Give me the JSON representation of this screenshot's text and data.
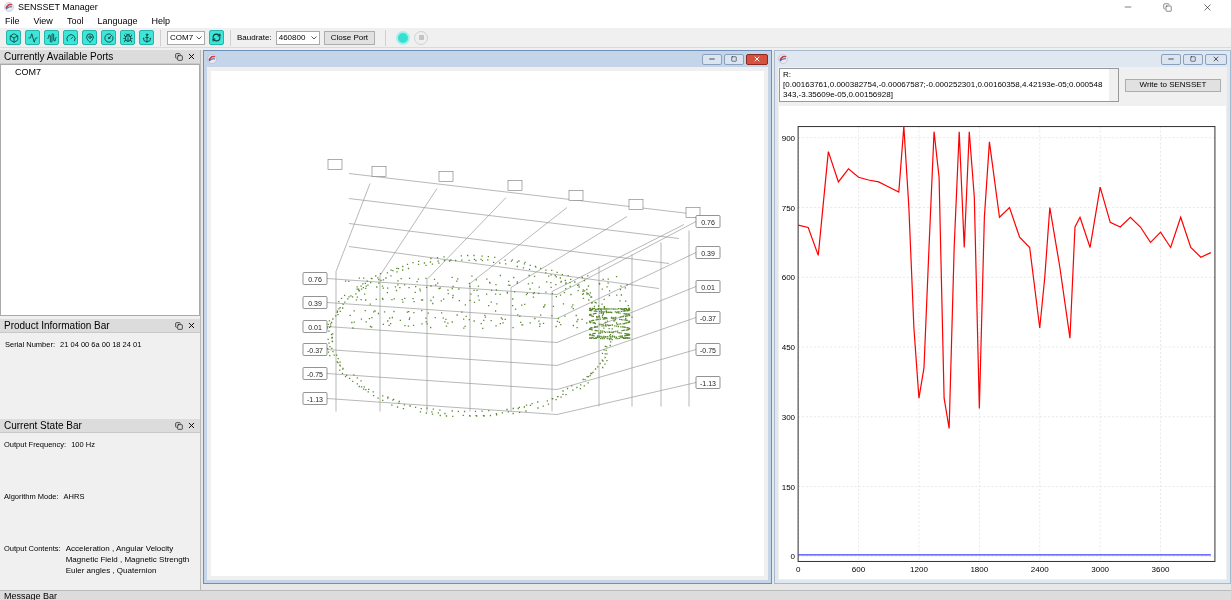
{
  "window": {
    "title": "SENSSET Manager"
  },
  "menu": [
    "File",
    "View",
    "Tool",
    "Language",
    "Help"
  ],
  "toolbar": {
    "port": "COM7",
    "baudrate_label": "Baudrate:",
    "baudrate": "460800",
    "close_port": "Close Port",
    "record": {
      "disabled": false
    },
    "stop": {
      "disabled": true
    }
  },
  "ports_panel": {
    "title": "Currently Available Ports",
    "ports": [
      "COM7"
    ]
  },
  "product_panel": {
    "title": "Product Information Bar",
    "fields": [
      {
        "label": "Serial Number:",
        "lines": [
          "21 04 00 6a 00 18 24 01"
        ]
      }
    ]
  },
  "state_panel": {
    "title": "Current State Bar",
    "fields": [
      {
        "label": "Output Frequency:",
        "lines": [
          "100 Hz"
        ]
      },
      {
        "label": "Algorithm Mode:",
        "lines": [
          "AHRS"
        ]
      },
      {
        "label": "Output Contents:",
        "lines": [
          "Acceleration , Angular Velocity",
          "Magnetic Field , Magnetic Strength",
          "Euler angles , Quaternion"
        ]
      }
    ]
  },
  "view3d": {
    "active": true,
    "left_ticks": [
      "0.76",
      "0.39",
      "0.01",
      "-0.37",
      "-0.75",
      "-1.13"
    ],
    "right_ticks": [
      "0.76",
      "0.39",
      "0.01",
      "-0.37",
      "-0.75",
      "-1.13"
    ]
  },
  "plot_window": {
    "active": false,
    "matrix_lines": [
      "R:",
      "[0.00163761,0.000382754,-0.00067587;-0.000252301,0.00160358,4.42193e-05;0.000548343,-3.35609e-05,0.00156928]"
    ],
    "write_button": "Write to SENSSET",
    "chart_data": {
      "type": "line",
      "x": [
        0,
        100,
        200,
        300,
        400,
        500,
        600,
        700,
        800,
        900,
        1000,
        1050,
        1100,
        1150,
        1200,
        1250,
        1300,
        1350,
        1400,
        1450,
        1500,
        1550,
        1600,
        1650,
        1700,
        1750,
        1800,
        1850,
        1900,
        2000,
        2100,
        2200,
        2300,
        2400,
        2450,
        2500,
        2600,
        2700,
        2750,
        2800,
        2900,
        3000,
        3100,
        3200,
        3300,
        3400,
        3500,
        3600,
        3700,
        3800,
        3900,
        4000,
        4100
      ],
      "series": [
        {
          "color": "#ff0000",
          "values": [
            712,
            707,
            647,
            870,
            805,
            833,
            815,
            809,
            805,
            794,
            783,
            924,
            750,
            491,
            340,
            405,
            664,
            913,
            815,
            340,
            275,
            664,
            913,
            664,
            913,
            772,
            318,
            729,
            891,
            729,
            750,
            686,
            664,
            491,
            600,
            750,
            621,
            469,
            708,
            729,
            664,
            794,
            718,
            708,
            729,
            708,
            675,
            697,
            664,
            729,
            664,
            643,
            653
          ]
        },
        {
          "color": "#4040ff",
          "values": [
            3,
            3,
            3,
            3,
            3,
            3,
            3,
            3,
            3,
            3,
            3,
            3,
            3,
            3,
            3,
            3,
            3,
            3,
            3,
            3,
            3,
            3,
            3,
            3,
            3,
            3,
            3,
            3,
            3,
            3,
            3,
            3,
            3,
            3,
            3,
            3,
            3,
            3,
            3,
            3,
            3,
            3,
            3,
            3,
            3,
            3,
            3,
            3,
            3,
            3,
            3,
            3,
            3
          ]
        }
      ],
      "grid": true,
      "xlim": [
        0,
        4140
      ],
      "ylim": [
        -11,
        924
      ],
      "xticks": [
        0,
        600,
        1200,
        1800,
        2400,
        3000,
        3600
      ],
      "yticks": [
        0,
        150,
        300,
        450,
        600,
        750,
        900
      ]
    }
  },
  "message_bar": {
    "title": "Message Bar"
  }
}
